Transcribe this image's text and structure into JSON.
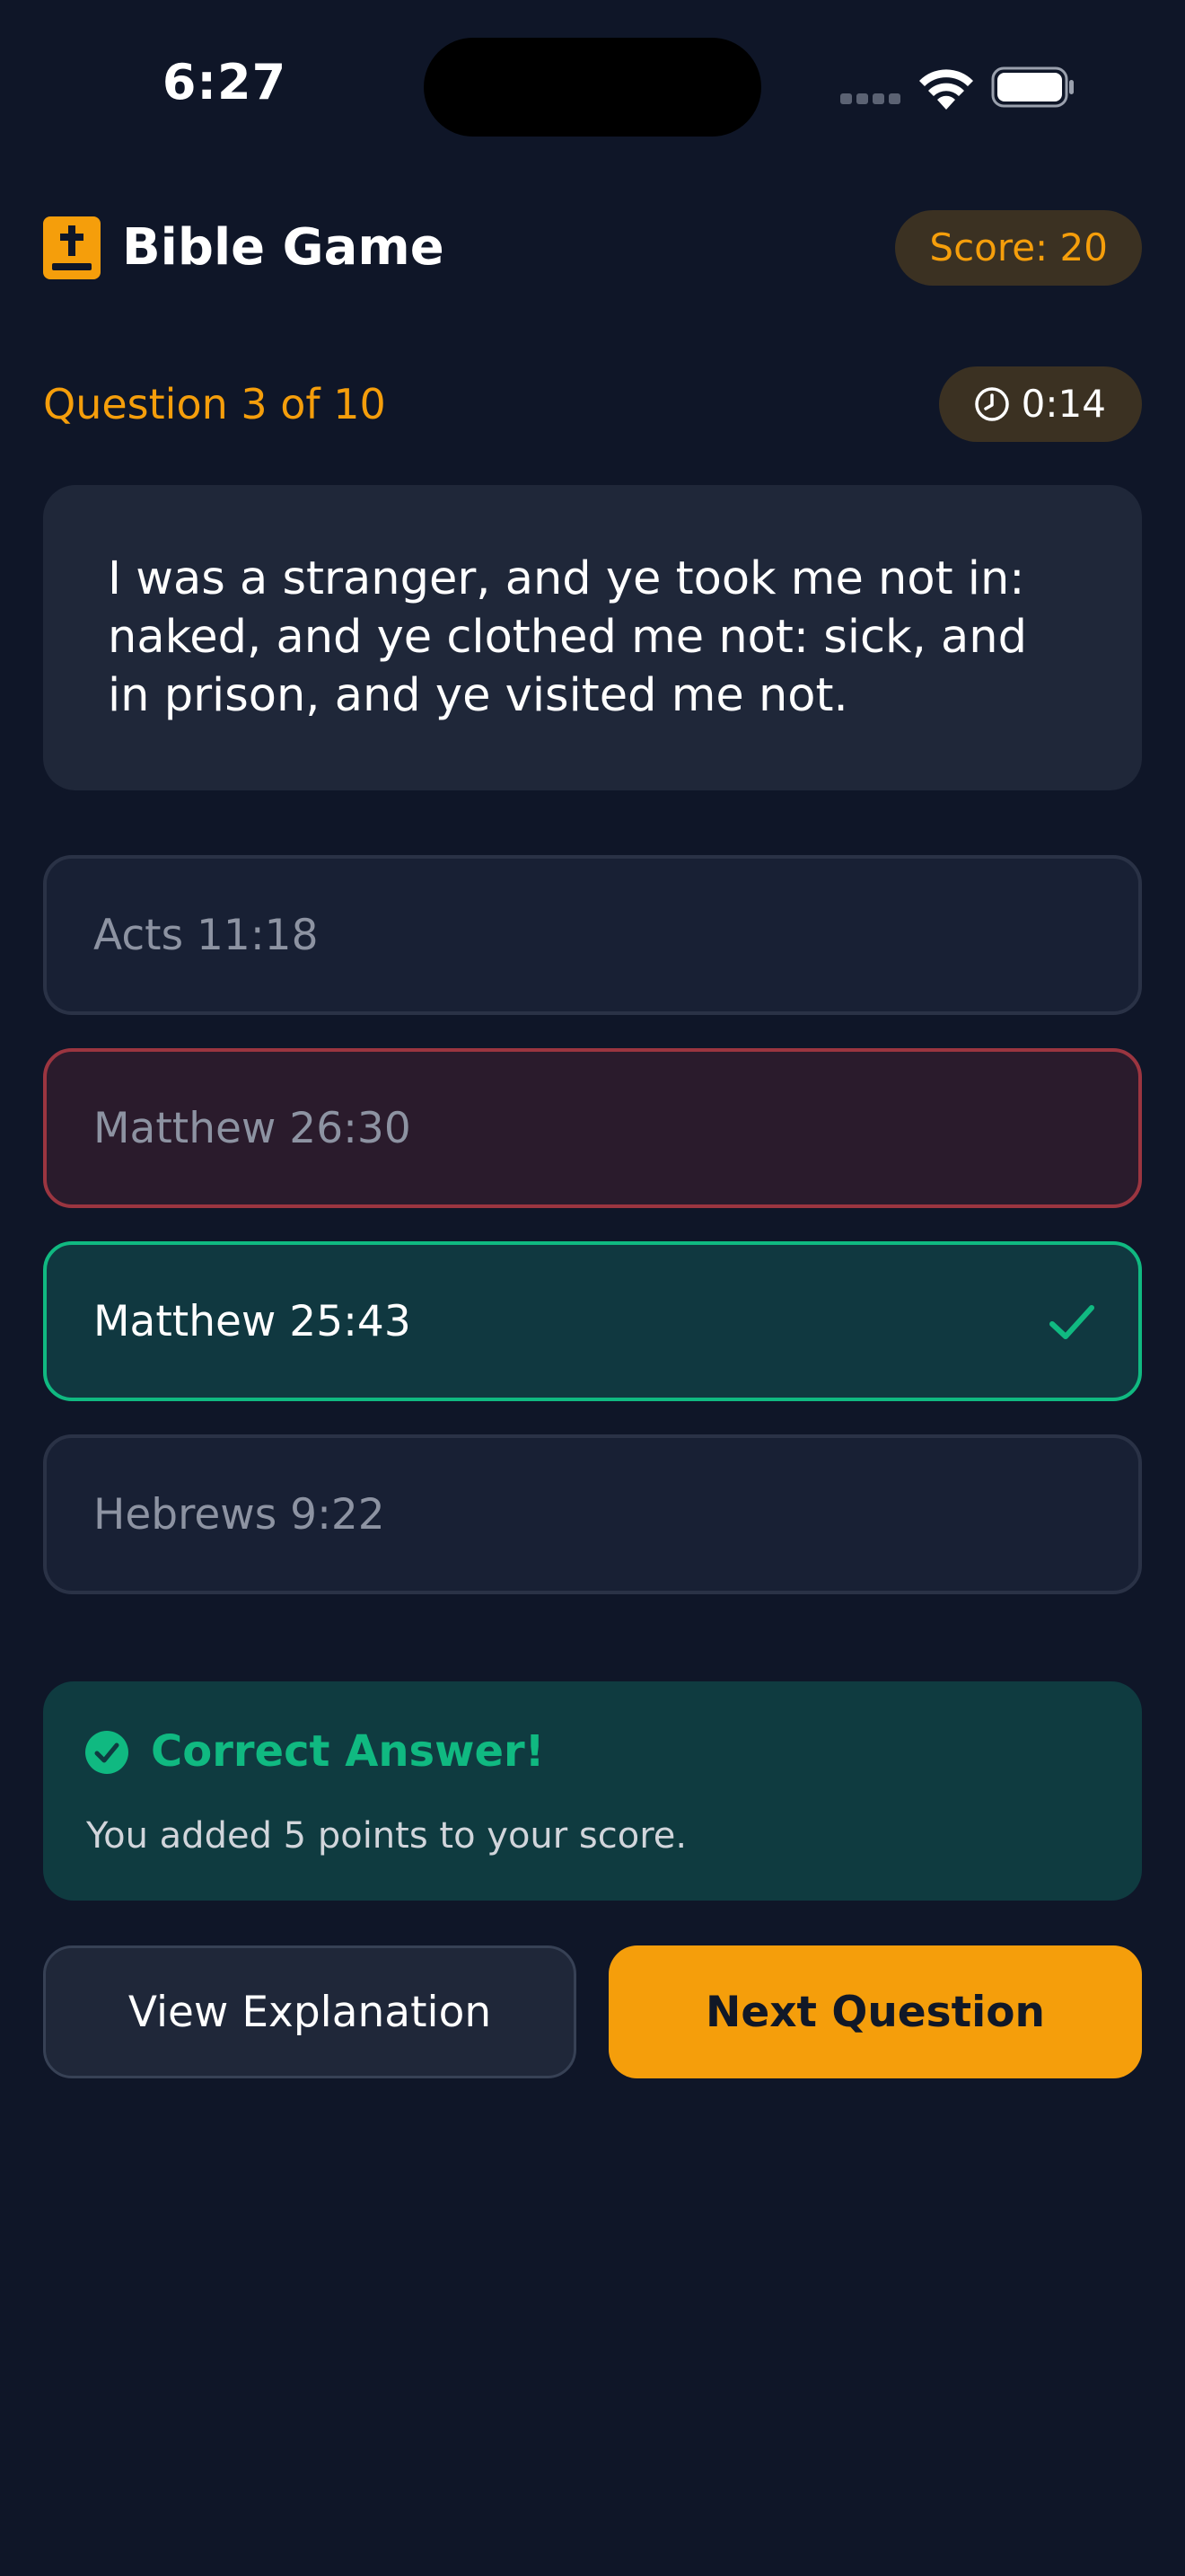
{
  "status_bar": {
    "time": "6:27",
    "icons": [
      "cellular-signal-icon",
      "wifi-icon",
      "battery-icon"
    ]
  },
  "header": {
    "logo_icon": "bible-cross-icon",
    "title": "Bible Game",
    "score_label": "Score: 20"
  },
  "question": {
    "counter": "Question 3 of 10",
    "timer_icon": "clock-icon",
    "timer": "0:14",
    "text": "I was a stranger, and ye took me not in: naked, and ye clothed me not: sick, and in prison, and ye visited me not."
  },
  "answers": [
    {
      "label": "Acts 11:18",
      "state": "default"
    },
    {
      "label": "Matthew 26:30",
      "state": "wrong"
    },
    {
      "label": "Matthew 25:43",
      "state": "correct",
      "icon": "checkmark-icon"
    },
    {
      "label": "Hebrews 9:22",
      "state": "default"
    }
  ],
  "feedback": {
    "icon": "check-circle-icon",
    "title": "Correct Answer!",
    "message": "You added 5 points to your score."
  },
  "actions": {
    "explain_label": "View Explanation",
    "next_label": "Next Question"
  },
  "colors": {
    "background": "#0f1628",
    "accent": "#f59e0b",
    "success": "#10b981",
    "error": "#9b3540",
    "card": "#1f2739"
  }
}
